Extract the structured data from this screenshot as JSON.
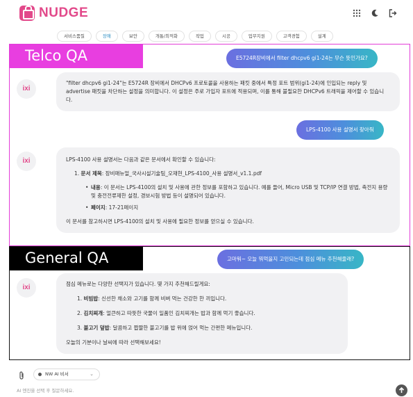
{
  "app": {
    "name": "NUDGE"
  },
  "top_icons": [
    "grid-icon",
    "moon-icon",
    "logout-icon"
  ],
  "tabs": [
    {
      "label": "서비스품질",
      "active": false
    },
    {
      "label": "장애",
      "active": true
    },
    {
      "label": "보안",
      "active": false
    },
    {
      "label": "개통/최적화",
      "active": false
    },
    {
      "label": "작업",
      "active": false
    },
    {
      "label": "시공",
      "active": false
    },
    {
      "label": "업무지원",
      "active": false
    },
    {
      "label": "고객경험",
      "active": false
    },
    {
      "label": "설계",
      "active": false
    }
  ],
  "sections": {
    "telco": {
      "label": "Telco QA",
      "color": "#e83ee0"
    },
    "general": {
      "label": "General QA",
      "color": "#000000"
    }
  },
  "avatar_label": "ixi",
  "chat": {
    "q1": "E5724R장비에서 filter dhcpv6 gi1-24는 무슨 뜻인가요?",
    "a1": "\"filter dhcpv6 gi1-24\"는 E5724R 장비에서 DHCPv6 프로토콜을 사용하는 패킷 중에서 특정 포트 범위(gi1-24)에 인입되는 reply 및 advertise 패킷을 차단하는 설정을 의미합니다. 이 설정은 주로 가입자 포트에 적용되며, 이를 통해 불필요한 DHCPv6 트래픽을 제어할 수 있습니다.",
    "q2": "LPS-4100 사용 설명서 찾아줘",
    "a2": {
      "intro": "LPS-4100 사용 설명서는 다음과 같은 문서에서 확인할 수 있습니다:",
      "item_num": "1.",
      "item_label": "문서 제목",
      "item_value": ": 장비매뉴얼_국사시설기술팀_오재현_LPS-4100_사용 설명서_v1.1.pdf",
      "bullets": [
        {
          "label": "내용",
          "value": ": 이 문서는 LPS-4100의 설치 및 사용에 관한 정보를 포함하고 있습니다. 예를 들어, Micro USB 및 TCP/IP 연결 방법, 축전지 용량 및 충전전류제한 설정, 경보시험 방법 등이 설명되어 있습니다."
        },
        {
          "label": "페이지",
          "value": ": 17-21페이지"
        }
      ],
      "outro": "이 문서를 참고하시면 LPS-4100의 설치 및 사용에 필요한 정보를 얻으실 수 있습니다."
    },
    "q3": "고마워~ 오늘 뭐먹을지 고민되는데 점심 메뉴 추천해줄래?",
    "a3": {
      "intro": "점심 메뉴로는 다양한 선택지가 있습니다. 몇 가지 추천해드릴게요:",
      "items": [
        {
          "num": "1.",
          "label": "비빔밥",
          "value": ": 신선한 채소와 고기를 함께 비벼 먹는 건강한 한 끼입니다."
        },
        {
          "num": "2.",
          "label": "김치찌개",
          "value": ": 얼큰하고 따뜻한 국물이 일품인 김치찌개는 밥과 함께 먹기 좋습니다."
        },
        {
          "num": "3.",
          "label": "불고기 덮밥",
          "value": ": 달콤하고 짭짤한 불고기를 밥 위에 얹어 먹는 간편한 메뉴입니다."
        }
      ],
      "outro": "오늘의 기분이나 날씨에 따라 선택해보세요!"
    }
  },
  "composer": {
    "model": "NW AI 비서",
    "hint": "AI 엔진을 선택 후 질문하세요."
  }
}
